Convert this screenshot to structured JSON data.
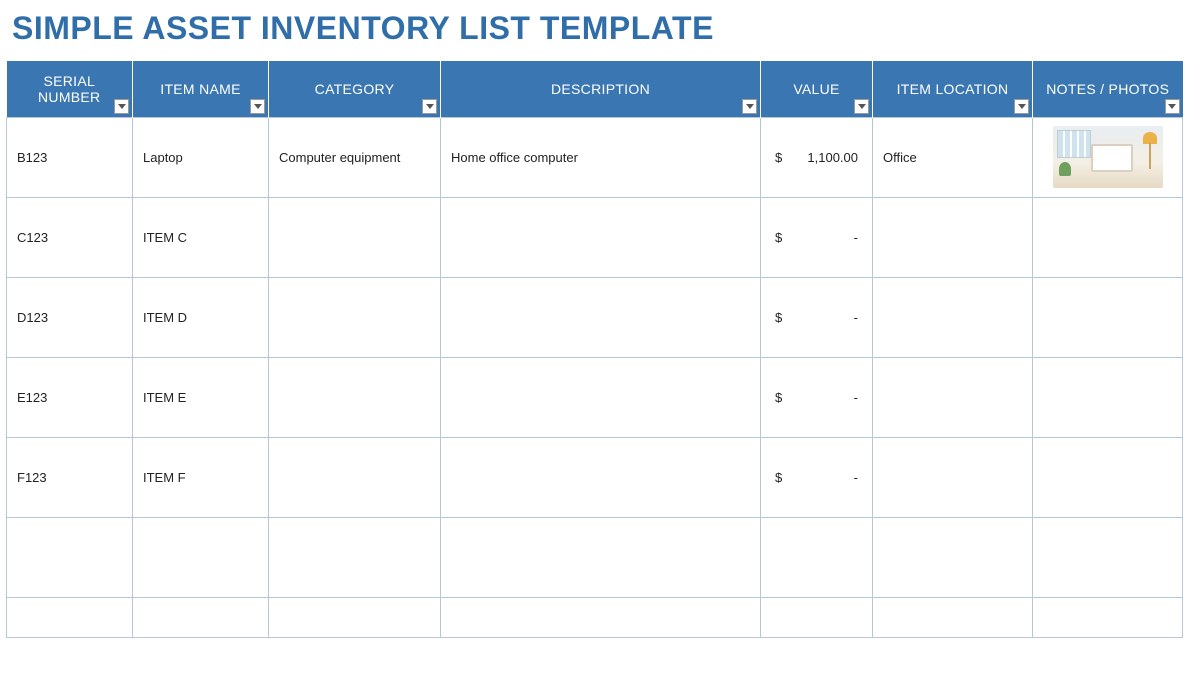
{
  "title": "SIMPLE ASSET INVENTORY LIST TEMPLATE",
  "columns": {
    "serial": "SERIAL NUMBER",
    "itemname": "ITEM NAME",
    "category": "CATEGORY",
    "desc": "DESCRIPTION",
    "value": "VALUE",
    "location": "ITEM LOCATION",
    "notes": "NOTES / PHOTOS"
  },
  "currency": "$",
  "dash": "-",
  "rows": [
    {
      "serial": "B123",
      "itemname": "Laptop",
      "category": "Computer equipment",
      "desc": "Home office computer",
      "value": "1,100.00",
      "location": "Office",
      "has_photo": true
    },
    {
      "serial": "C123",
      "itemname": "ITEM C",
      "category": "",
      "desc": "",
      "value": "",
      "location": "",
      "has_photo": false
    },
    {
      "serial": "D123",
      "itemname": "ITEM D",
      "category": "",
      "desc": "",
      "value": "",
      "location": "",
      "has_photo": false
    },
    {
      "serial": "E123",
      "itemname": "ITEM E",
      "category": "",
      "desc": "",
      "value": "",
      "location": "",
      "has_photo": false
    },
    {
      "serial": "F123",
      "itemname": "ITEM F",
      "category": "",
      "desc": "",
      "value": "",
      "location": "",
      "has_photo": false
    },
    {
      "serial": "",
      "itemname": "",
      "category": "",
      "desc": "",
      "value_empty": true,
      "location": "",
      "has_photo": false
    },
    {
      "serial": "",
      "itemname": "",
      "category": "",
      "desc": "",
      "value_empty": true,
      "location": "",
      "has_photo": false,
      "partial": true
    }
  ]
}
